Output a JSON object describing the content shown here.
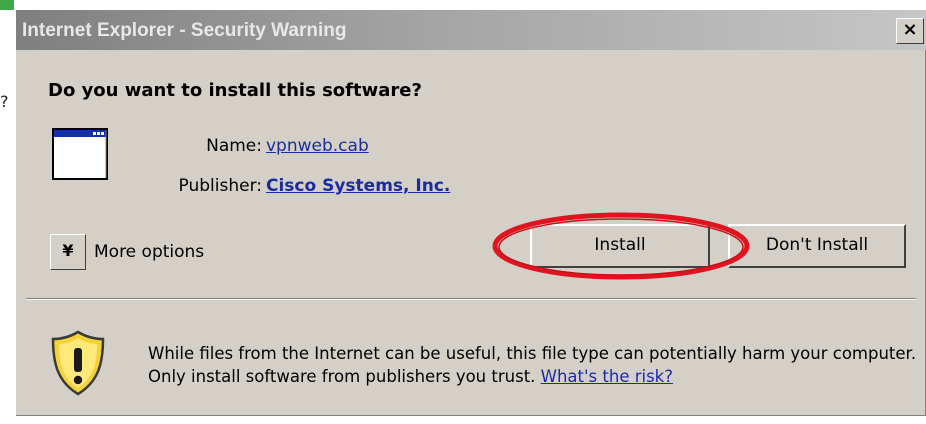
{
  "window": {
    "title": "Internet Explorer - Security Warning",
    "close_label": "×"
  },
  "background": {
    "edge_glyph": "?"
  },
  "dialog": {
    "heading": "Do you want to install this software?",
    "name_label": "Name:",
    "name_value": "vpnweb.cab",
    "publisher_label": "Publisher:",
    "publisher_value": "Cisco Systems, Inc.",
    "more_options_toggle": "¥",
    "more_options_label": "More options",
    "install_label": "Install",
    "dont_install_label": "Don't Install",
    "warning_text": "While files from the Internet can be useful, this file type can potentially harm your computer. Only install software from publishers you trust.",
    "risk_link": "What's the risk?"
  },
  "colors": {
    "dialog_bg": "#d4d0c8",
    "link": "#1c2ca0",
    "highlight_ring": "#e0141e",
    "shield_yellow": "#f6d23a"
  },
  "icons": [
    "application-window-icon",
    "security-shield-icon",
    "close-icon",
    "chevron-down-icon"
  ]
}
